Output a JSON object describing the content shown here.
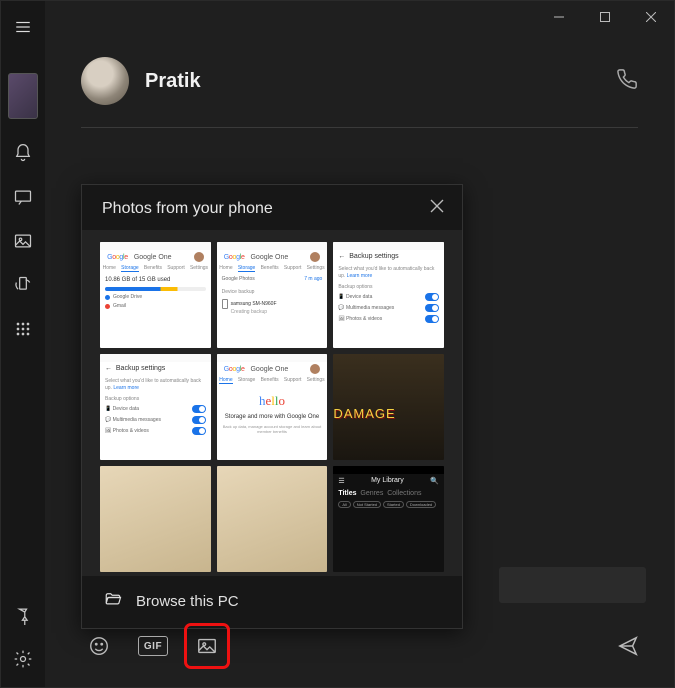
{
  "titlebar": {
    "minimize": "Minimize",
    "maximize": "Maximize",
    "close": "Close"
  },
  "sidebar": {
    "menu": "Menu",
    "phone": "Phone",
    "notifications": "Notifications",
    "messages": "Messages",
    "photos": "Photos",
    "hotspot": "Phone screen",
    "apps": "Apps",
    "pin": "Pin",
    "settings": "Settings"
  },
  "contact": {
    "name": "Pratik",
    "call": "Call"
  },
  "popup": {
    "title": "Photos from your phone",
    "close": "Close",
    "browse_label": "Browse this PC",
    "thumbs": [
      {
        "kind": "google-one-storage",
        "title": "Google One",
        "line": "10.86 GB of 15 GB used",
        "sub": "Google Drive",
        "sub2": "Gmail"
      },
      {
        "kind": "google-one-backup",
        "title": "Google One",
        "line": "Google Photos",
        "line2": "samsung SM-N960F",
        "sub": "Creating backup"
      },
      {
        "kind": "backup-settings",
        "title": "Backup settings",
        "row1": "Device data",
        "row2": "Multimedia messages",
        "row3": "Photos & videos"
      },
      {
        "kind": "backup-settings",
        "title": "Backup settings",
        "row1": "Device data",
        "row2": "Multimedia messages",
        "row3": "Photos & videos"
      },
      {
        "kind": "google-one-hello",
        "title": "Google One",
        "hello": "hello",
        "line": "Storage and more with Google One"
      },
      {
        "kind": "damage",
        "title": "DAMAGE"
      },
      {
        "kind": "paper-note",
        "title": ""
      },
      {
        "kind": "paper-note",
        "title": ""
      },
      {
        "kind": "library",
        "title": "My Library",
        "tabs": "Titles   Genres   Collections"
      }
    ]
  },
  "composer": {
    "emoji": "Emoji",
    "gif_label": "GIF",
    "image": "Attach image",
    "send": "Send"
  }
}
